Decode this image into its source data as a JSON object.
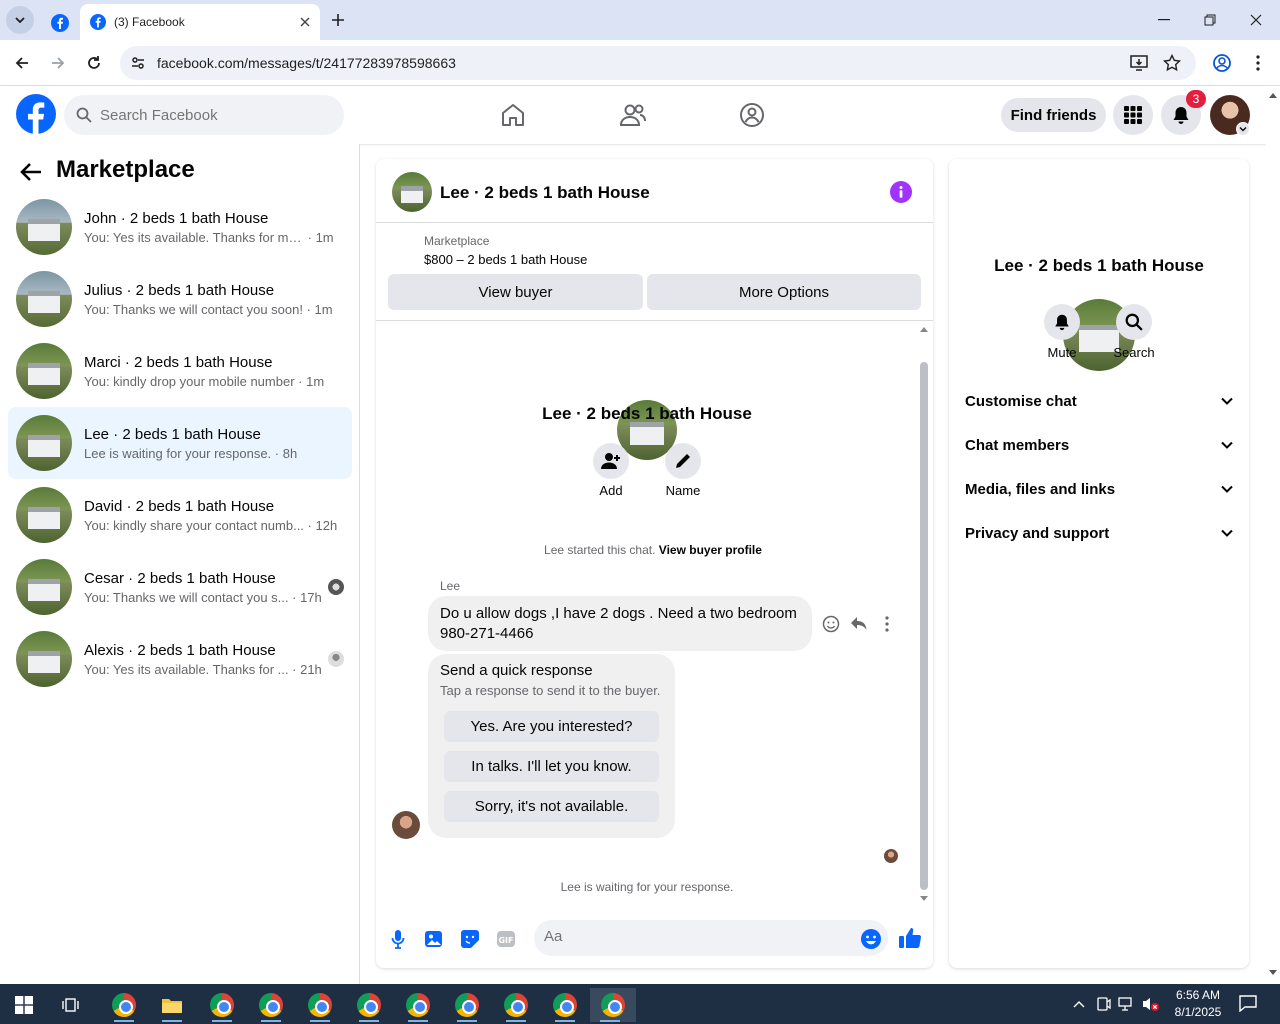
{
  "browser": {
    "tab_title": "(3) Facebook",
    "url": "facebook.com/messages/t/24177283978598663"
  },
  "fb": {
    "search_placeholder": "Search Facebook",
    "find_friends": "Find friends",
    "notif_count": "3"
  },
  "left": {
    "title": "Marketplace",
    "conversations": [
      {
        "name": "John · 2 beds 1 bath House",
        "preview": "You: Yes its available. Thanks for mess...",
        "time": "1m"
      },
      {
        "name": "Julius · 2 beds 1 bath House",
        "preview": "You: Thanks we will contact you soon!",
        "time": "1m"
      },
      {
        "name": "Marci · 2 beds 1 bath House",
        "preview": "You: kindly drop your mobile number",
        "time": "1m"
      },
      {
        "name": "Lee · 2 beds 1 bath House",
        "preview": "Lee is waiting for your response.",
        "time": "8h"
      },
      {
        "name": "David · 2 beds 1 bath House",
        "preview": "You: kindly share your contact numb...",
        "time": "12h"
      },
      {
        "name": "Cesar · 2 beds 1 bath House",
        "preview": "You: Thanks we will contact you s...",
        "time": "17h"
      },
      {
        "name": "Alexis · 2 beds 1 bath House",
        "preview": "You: Yes its available. Thanks for ...",
        "time": "21h"
      }
    ]
  },
  "chat": {
    "title": "Lee · 2 beds 1 bath House",
    "marketplace_label": "Marketplace",
    "listing": "$800 – 2 beds 1 bath House",
    "view_buyer": "View buyer",
    "more_options": "More Options",
    "add_label": "Add",
    "name_label": "Name",
    "started_text": "Lee started this chat.",
    "view_profile": "View buyer profile",
    "sender": "Lee",
    "message_line1": "Do u allow dogs ,I have 2 dogs . Need a two bedroom",
    "message_line2": "980-271-4466",
    "quick_title": "Send a quick response",
    "quick_sub": "Tap a response to send it to the buyer.",
    "quick_responses": [
      "Yes. Are you interested?",
      "In talks. I'll let you know.",
      "Sorry, it's not available."
    ],
    "waiting": "Lee is waiting for your response.",
    "input_placeholder": "Aa"
  },
  "right": {
    "title": "Lee · 2 beds 1 bath House",
    "mute": "Mute",
    "search": "Search",
    "sections": [
      "Customise chat",
      "Chat members",
      "Media, files and links",
      "Privacy and support"
    ]
  },
  "taskbar": {
    "time": "6:56 AM",
    "date": "8/1/2025"
  },
  "colors": {
    "fb_blue": "#0866ff",
    "selected_bg": "#ebf5ff",
    "badge_red": "#e41e3f",
    "info_purple": "#a033ff"
  }
}
